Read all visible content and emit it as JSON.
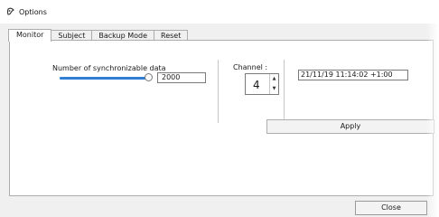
{
  "window": {
    "title": "Options"
  },
  "tabs": [
    {
      "label": "Monitor"
    },
    {
      "label": "Subject"
    },
    {
      "label": "Backup Mode"
    },
    {
      "label": "Reset"
    }
  ],
  "monitor": {
    "sync_label": "Number of synchronizable data",
    "sync_value": "2000",
    "channel_label": "Channel :",
    "channel_value": "4",
    "datetime": "21/11/19 11:14:02 +1:00"
  },
  "buttons": {
    "apply": "Apply",
    "close": "Close"
  },
  "icons": {
    "app": "options-app-icon",
    "spin_up": "spin-up-icon",
    "spin_down": "spin-down-icon"
  },
  "colors": {
    "slider_accent": "#2f7fd6"
  }
}
